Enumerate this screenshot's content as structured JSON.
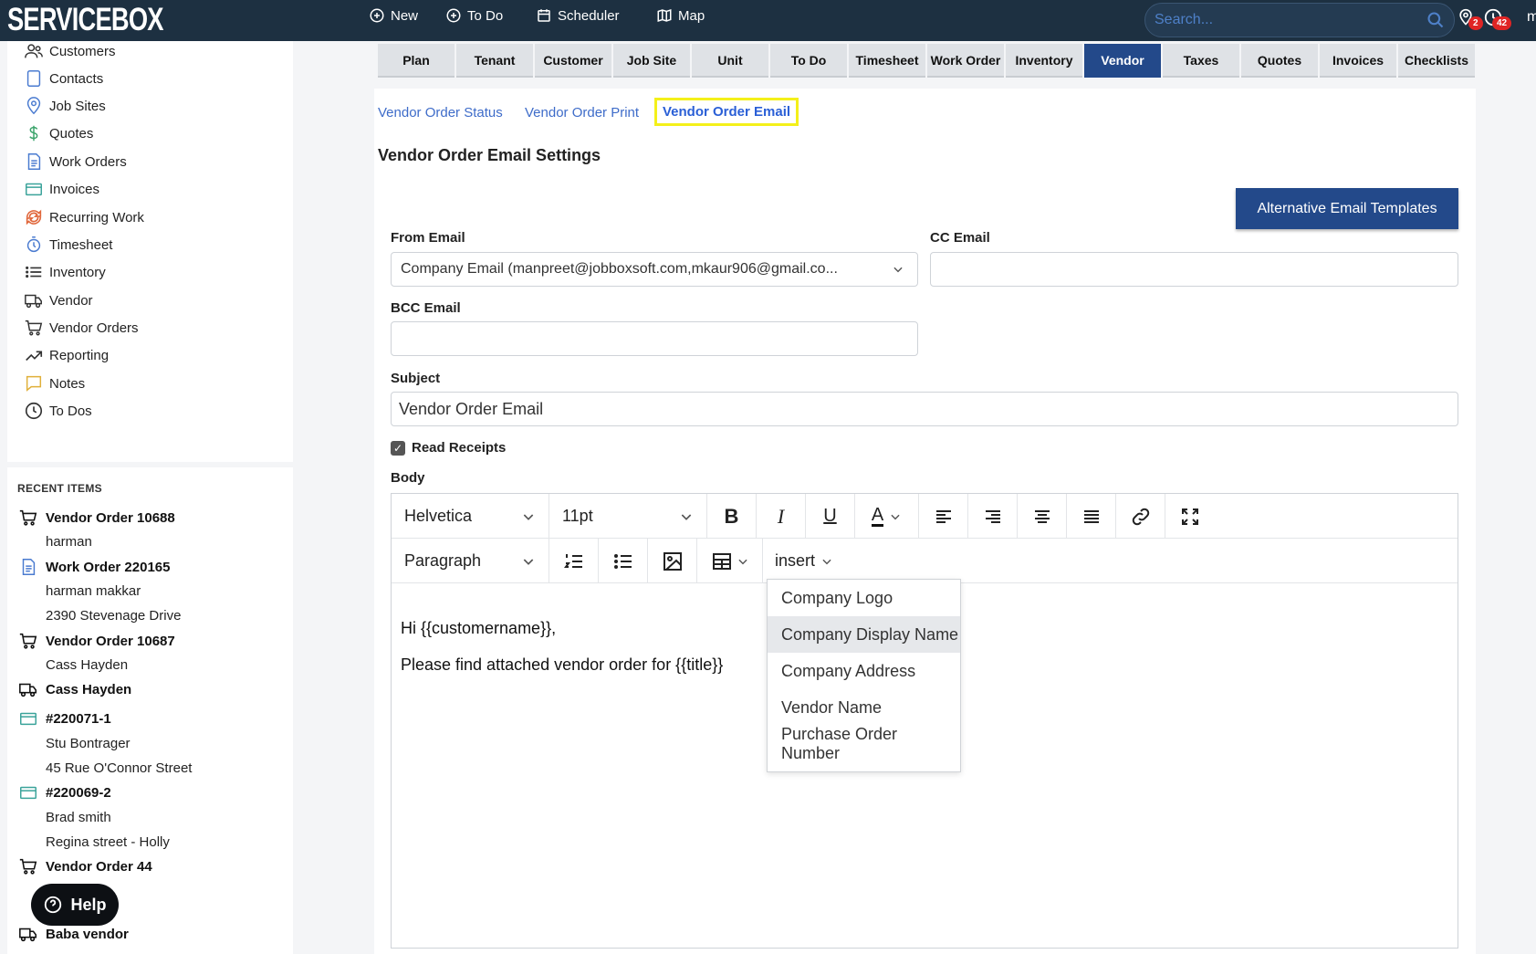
{
  "brand": "SERVICEBOX",
  "topnav": {
    "new": "New",
    "todo": "To Do",
    "scheduler": "Scheduler",
    "map": "Map"
  },
  "search": {
    "placeholder": "Search..."
  },
  "notifications": {
    "location_count": "2",
    "clock_count": "42",
    "user_initial": "m"
  },
  "sidebar": {
    "items": [
      "Customers",
      "Contacts",
      "Job Sites",
      "Quotes",
      "Work Orders",
      "Invoices",
      "Recurring Work",
      "Timesheet",
      "Inventory",
      "Vendor",
      "Vendor Orders",
      "Reporting",
      "Notes",
      "To Dos"
    ]
  },
  "recent": {
    "title": "RECENT ITEMS",
    "items": [
      {
        "title": "Vendor Order 10688",
        "subs": [
          "harman"
        ]
      },
      {
        "title": "Work Order 220165",
        "subs": [
          "harman makkar",
          "2390 Stevenage Drive"
        ]
      },
      {
        "title": "Vendor Order 10687",
        "subs": [
          "Cass Hayden"
        ]
      },
      {
        "title": "Cass Hayden",
        "subs": []
      },
      {
        "title": "#220071-1",
        "subs": [
          "Stu Bontrager",
          "45 Rue O'Connor Street"
        ]
      },
      {
        "title": "#220069-2",
        "subs": [
          "Brad smith",
          "Regina street - Holly"
        ]
      },
      {
        "title": "Vendor Order 44",
        "subs": []
      },
      {
        "title": "Baba vendor",
        "subs": []
      }
    ],
    "help": "Help"
  },
  "tabs": [
    "Plan",
    "Tenant",
    "Customer",
    "Job Site",
    "Unit",
    "To Do",
    "Timesheet",
    "Work Order",
    "Inventory",
    "Vendor",
    "Taxes",
    "Quotes",
    "Invoices",
    "Checklists"
  ],
  "active_tab": "Vendor",
  "sublinks": {
    "status": "Vendor Order Status",
    "print": "Vendor Order Print",
    "email": "Vendor Order Email"
  },
  "page": {
    "title": "Vendor Order Email Settings",
    "alt_templates": "Alternative Email Templates",
    "from_label": "From Email",
    "from_value": "Company Email (manpreet@jobboxsoft.com,mkaur906@gmail.co...",
    "cc_label": "CC Email",
    "cc_value": "",
    "bcc_label": "BCC Email",
    "bcc_value": "",
    "subject_label": "Subject",
    "subject_value": "Vendor Order Email",
    "read_receipts": "Read Receipts",
    "read_receipts_checked": true,
    "body_label": "Body"
  },
  "editor": {
    "font": "Helvetica",
    "size": "11pt",
    "block": "Paragraph",
    "insert": "insert",
    "line1": "Hi {{customername}},",
    "line2": "Please find attached vendor order for {{title}}"
  },
  "insert_menu": [
    "Company Logo",
    "Company Display Name",
    "Company Address",
    "Vendor Name",
    "Purchase Order Number"
  ],
  "insert_menu_highlight": "Company Display Name"
}
